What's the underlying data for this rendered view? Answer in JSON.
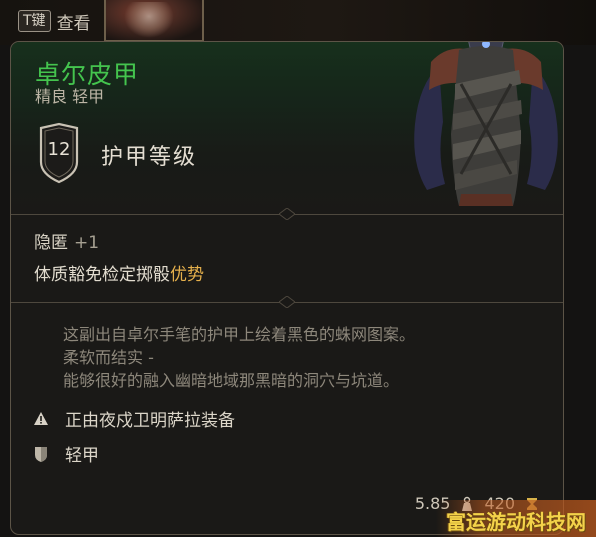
{
  "hint": {
    "key": "T键",
    "text": "查看"
  },
  "item": {
    "name": "卓尔皮甲",
    "subtitle": "精良 轻甲",
    "armor_class": "12",
    "armor_class_label": "护甲等级",
    "bonus": {
      "name": "隐匿",
      "value": "+1",
      "desc_prefix": "体质豁免检定掷骰",
      "desc_highlight": "优势"
    },
    "flavor": [
      "这副出自卓尔手笔的护甲上绘着黑色的蛛网图案。",
      "柔软而结实 -",
      "能够很好的融入幽暗地域那黑暗的洞穴与坑道。"
    ],
    "equipped_by": "正由夜戍卫明萨拉装备",
    "armor_type": "轻甲",
    "weight": "5.85",
    "price": "420"
  },
  "watermark": "富运游动科技网",
  "colors": {
    "rarity_green": "#44c44e",
    "highlight_gold": "#e5b04c",
    "border": "#5c5447"
  },
  "icons": {
    "ac": "shield-icon",
    "warning": "warning-icon",
    "armor_type": "light-armor-icon",
    "weight": "weight-icon",
    "price": "coin-icon"
  }
}
